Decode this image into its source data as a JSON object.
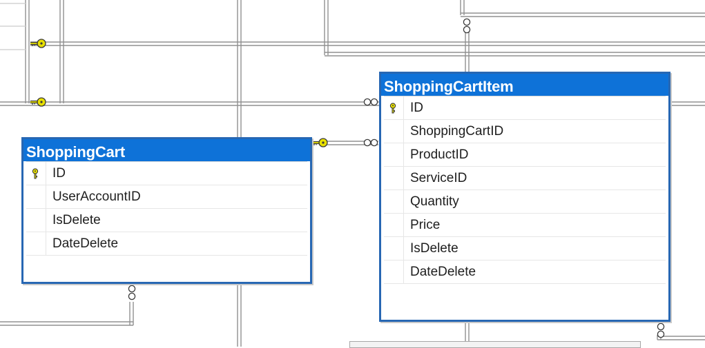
{
  "colors": {
    "title_bg": "#0e72d8",
    "border": "#2767b3",
    "key": "#e8e000",
    "line": "#909090"
  },
  "tables": [
    {
      "title": "ShoppingCart",
      "columns": [
        {
          "name": "ID",
          "pk": true
        },
        {
          "name": "UserAccountID",
          "pk": false
        },
        {
          "name": "IsDelete",
          "pk": false
        },
        {
          "name": "DateDelete",
          "pk": false
        }
      ]
    },
    {
      "title": "ShoppingCartItem",
      "columns": [
        {
          "name": "ID",
          "pk": true
        },
        {
          "name": "ShoppingCartID",
          "pk": false
        },
        {
          "name": "ProductID",
          "pk": false
        },
        {
          "name": "ServiceID",
          "pk": false
        },
        {
          "name": "Quantity",
          "pk": false
        },
        {
          "name": "Price",
          "pk": false
        },
        {
          "name": "IsDelete",
          "pk": false
        },
        {
          "name": "DateDelete",
          "pk": false
        }
      ]
    }
  ]
}
